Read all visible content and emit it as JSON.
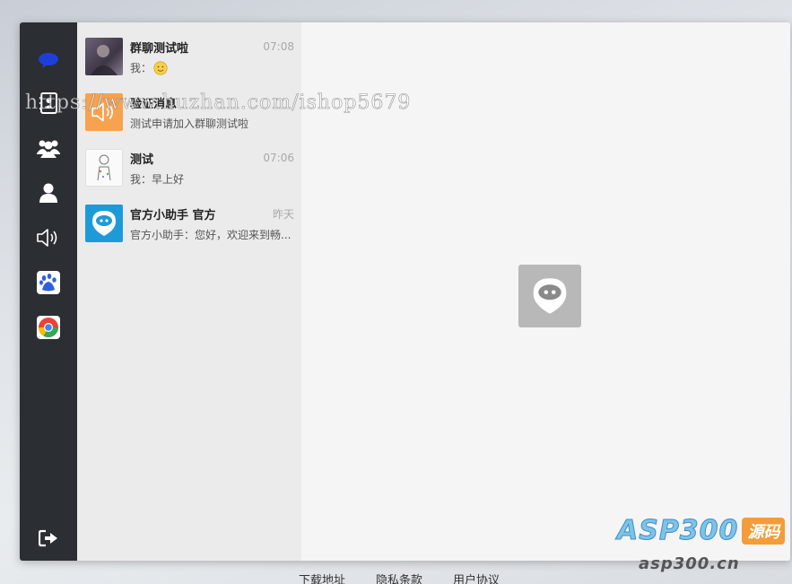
{
  "conversations": [
    {
      "name": "群聊测试啦",
      "time": "07:08",
      "message": "我：",
      "emoji": "smile"
    },
    {
      "name": "验证消息",
      "time": "",
      "message": "测试申请加入群聊测试啦"
    },
    {
      "name": "测试",
      "time": "07:06",
      "message": "我：早上好"
    },
    {
      "name": "官方小助手 官方",
      "time": "昨天",
      "message": "官方小助手：您好，欢迎来到畅..."
    }
  ],
  "footer": {
    "download": "下载地址",
    "privacy": "隐私条款",
    "agreement": "用户协议"
  },
  "watermark": "https://www.huzhan.com/ishop5679",
  "brand": {
    "main": "ASP300",
    "badge": "源码",
    "sub": "asp300.cn"
  },
  "colors": {
    "sidebar": "#2b2e33",
    "list_bg": "#ebebeb",
    "main_bg": "#f5f5f5",
    "assistant_blue": "#1d9bd8",
    "notice_orange": "#f7a24f"
  }
}
